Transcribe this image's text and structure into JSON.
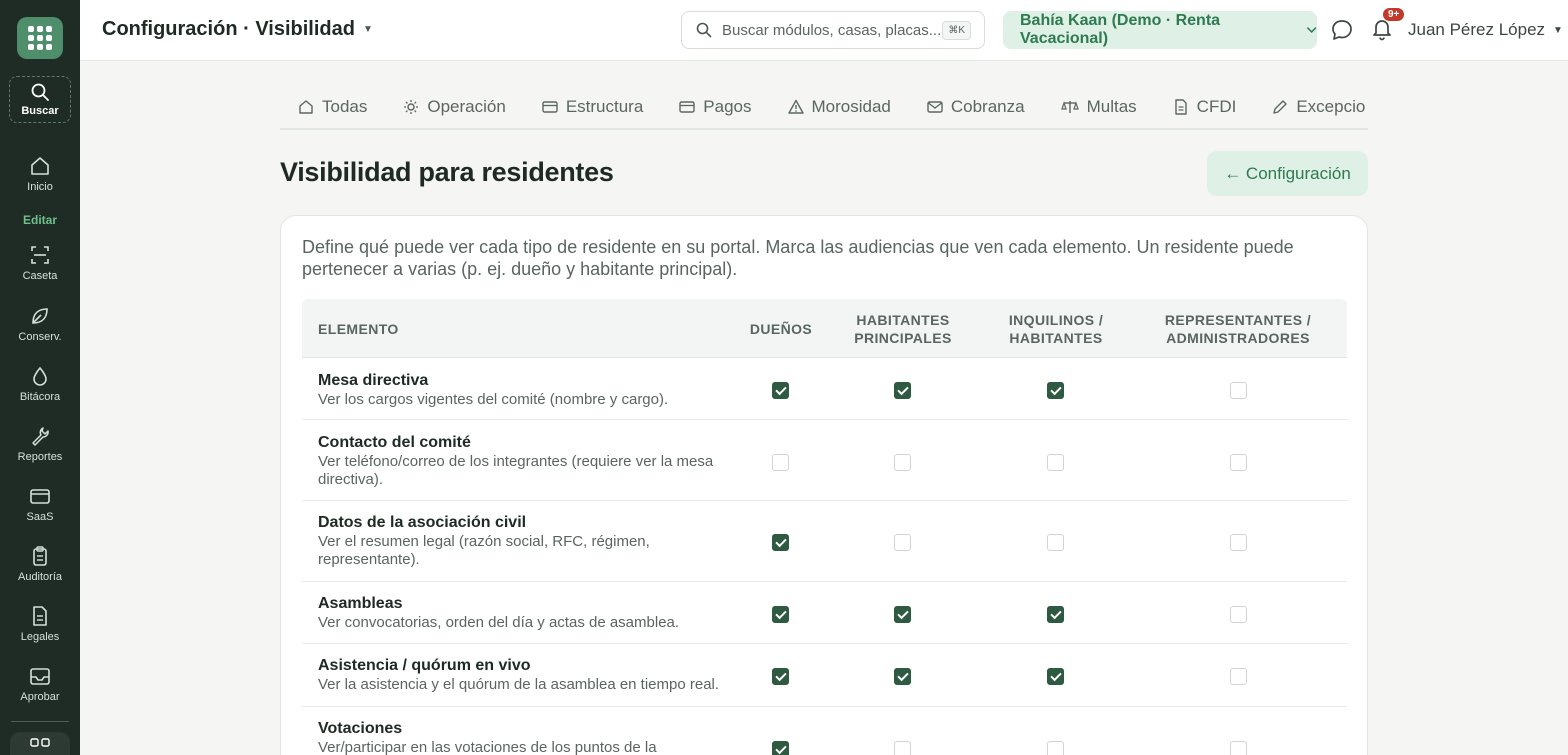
{
  "app": {
    "sidebar": {
      "search_label": "Buscar",
      "items_top": [
        {
          "label": "Inicio",
          "icon": "home-icon"
        }
      ],
      "section_label": "Editar",
      "items": [
        {
          "label": "Caseta",
          "icon": "scan-icon"
        },
        {
          "label": "Conserv.",
          "icon": "leaf-icon"
        },
        {
          "label": "Bitácora",
          "icon": "droplet-icon"
        },
        {
          "label": "Reportes",
          "icon": "wrench-icon"
        },
        {
          "label": "SaaS",
          "icon": "card-icon"
        },
        {
          "label": "Auditoría",
          "icon": "clipboard-icon"
        },
        {
          "label": "Legales",
          "icon": "document-icon"
        },
        {
          "label": "Aprobar",
          "icon": "inbox-icon"
        }
      ]
    },
    "header": {
      "title": "Configuración · Visibilidad",
      "search_placeholder": "Buscar módulos, casas, placas...",
      "search_shortcut": "⌘K",
      "org_name": "Bahía Kaan (Demo · Renta Vacacional)",
      "notification_count": "9+",
      "user_name": "Juan Pérez López"
    }
  },
  "tabs": [
    {
      "label": "Todas",
      "icon": "home-icon"
    },
    {
      "label": "Operación",
      "icon": "sun-icon"
    },
    {
      "label": "Estructura",
      "icon": "card-icon"
    },
    {
      "label": "Pagos",
      "icon": "card-icon"
    },
    {
      "label": "Morosidad",
      "icon": "warning-icon"
    },
    {
      "label": "Cobranza",
      "icon": "mail-icon"
    },
    {
      "label": "Multas",
      "icon": "scale-icon"
    },
    {
      "label": "CFDI",
      "icon": "document-icon"
    },
    {
      "label": "Excepcio",
      "icon": "pencil-icon"
    }
  ],
  "page": {
    "title": "Visibilidad para residentes",
    "back_label": "← Configuración",
    "intro": "Define qué puede ver cada tipo de residente en su portal. Marca las audiencias que ven cada elemento. Un residente puede pertenecer a varias (p. ej. dueño y habitante principal)."
  },
  "table": {
    "columns": [
      "ELEMENTO",
      "DUEÑOS",
      "HABITANTES PRINCIPALES",
      "INQUILINOS / HABITANTES",
      "REPRESENTANTES / ADMINISTRADORES"
    ],
    "rows": [
      {
        "name": "Mesa directiva",
        "desc": "Ver los cargos vigentes del comité (nombre y cargo).",
        "checks": [
          true,
          true,
          true,
          false
        ]
      },
      {
        "name": "Contacto del comité",
        "desc": "Ver teléfono/correo de los integrantes (requiere ver la mesa directiva).",
        "checks": [
          false,
          false,
          false,
          false
        ]
      },
      {
        "name": "Datos de la asociación civil",
        "desc": "Ver el resumen legal (razón social, RFC, régimen, representante).",
        "checks": [
          true,
          false,
          false,
          false
        ]
      },
      {
        "name": "Asambleas",
        "desc": "Ver convocatorias, orden del día y actas de asamblea.",
        "checks": [
          true,
          true,
          true,
          false
        ]
      },
      {
        "name": "Asistencia / quórum en vivo",
        "desc": "Ver la asistencia y el quórum de la asamblea en tiempo real.",
        "checks": [
          true,
          true,
          true,
          false
        ]
      },
      {
        "name": "Votaciones",
        "desc": "Ver/participar en las votaciones de los puntos de la",
        "checks": [
          true,
          false,
          false,
          false
        ]
      }
    ]
  }
}
